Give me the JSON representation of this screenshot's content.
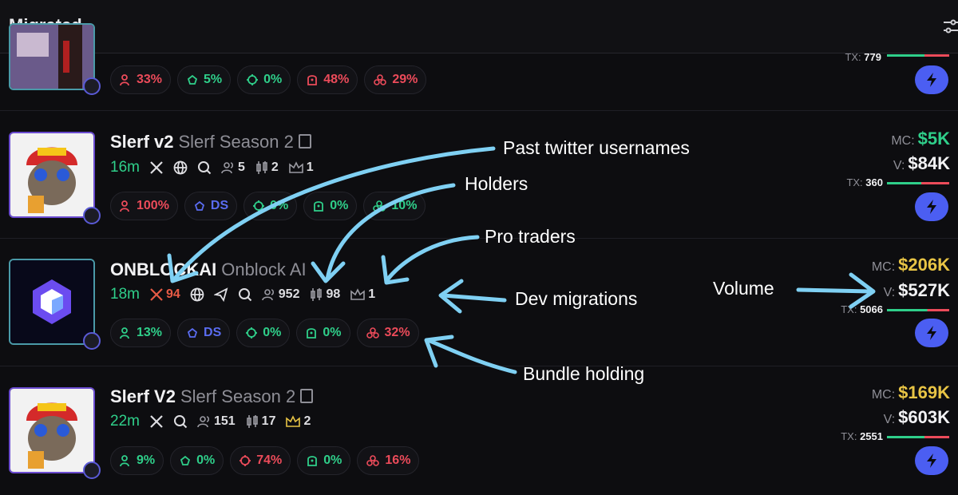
{
  "header": {
    "title": "Migrated"
  },
  "rows": [
    {
      "tx": "779",
      "stats": [
        "33%",
        "5%",
        "0%",
        "48%",
        "29%"
      ]
    },
    {
      "symbol": "Slerf v2",
      "name": "Slerf Season 2",
      "age": "16m",
      "holders": "5",
      "pro_traders": "2",
      "dev_migrations": "1",
      "stats": [
        "100%",
        "DS",
        "0%",
        "0%",
        "10%"
      ],
      "mc": "$5K",
      "volume": "$84K",
      "tx": "360"
    },
    {
      "symbol": "ONBLOCKAI",
      "name": "Onblock AI",
      "age": "18m",
      "twitter_renames": "94",
      "holders": "952",
      "pro_traders": "98",
      "dev_migrations": "1",
      "stats": [
        "13%",
        "DS",
        "0%",
        "0%",
        "32%"
      ],
      "mc": "$206K",
      "volume": "$527K",
      "tx": "5066"
    },
    {
      "symbol": "Slerf V2",
      "name": "Slerf Season 2",
      "age": "22m",
      "holders": "151",
      "pro_traders": "17",
      "dev_migrations": "2",
      "stats": [
        "9%",
        "0%",
        "74%",
        "0%",
        "16%"
      ],
      "mc": "$169K",
      "volume": "$603K",
      "tx": "2551"
    }
  ],
  "labels": {
    "mc": "MC:",
    "volume": "V:",
    "tx": "TX:"
  },
  "annotations": {
    "twitter": "Past twitter usernames",
    "holders": "Holders",
    "pro_traders": "Pro traders",
    "dev_migrations": "Dev migrations",
    "volume": "Volume",
    "bundle": "Bundle holding"
  },
  "colors": {
    "accent": "#4b5ef2",
    "green": "#2fcf8a",
    "red": "#ec4b5a",
    "gold": "#e8c445",
    "annotation_arrow": "#7fd0f3"
  },
  "icons": [
    "filter-icon",
    "x-twitter-icon",
    "globe-icon",
    "search-icon",
    "telegram-icon",
    "holders-icon",
    "candles-icon",
    "crown-icon",
    "copy-icon",
    "bolt-icon",
    "top10-icon",
    "dev-icon",
    "sniper-icon",
    "insider-icon",
    "bundle-icon"
  ]
}
